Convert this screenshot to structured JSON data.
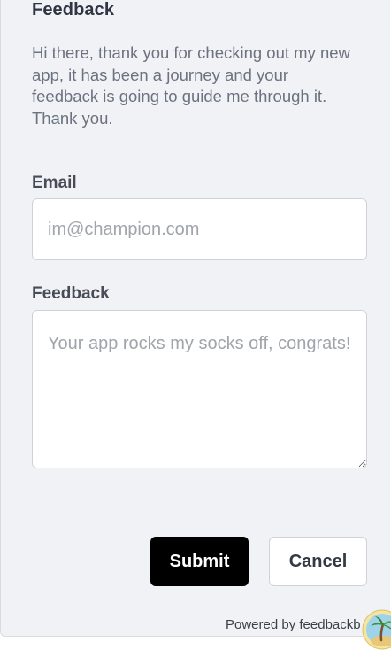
{
  "form": {
    "title": "Feedback",
    "intro": "Hi there, thank you for checking out my new app, it has been a journey and your feedback is going to guide me through it. Thank you.",
    "email_label": "Email",
    "email_value": "",
    "email_placeholder": "im@champion.com",
    "feedback_label": "Feedback",
    "feedback_value": "",
    "feedback_placeholder": "Your app rocks my socks off, congrats!",
    "submit_label": "Submit",
    "cancel_label": "Cancel"
  },
  "footer": {
    "powered_by": "Powered by feedbackb",
    "logo_icon": "island-palm-icon"
  },
  "colors": {
    "panel_background": "#f1f2f5",
    "submit_background": "#000000",
    "submit_text": "#ffffff",
    "cancel_background": "#ffffff",
    "body_text": "#6b7280",
    "label_text": "#474d58"
  }
}
